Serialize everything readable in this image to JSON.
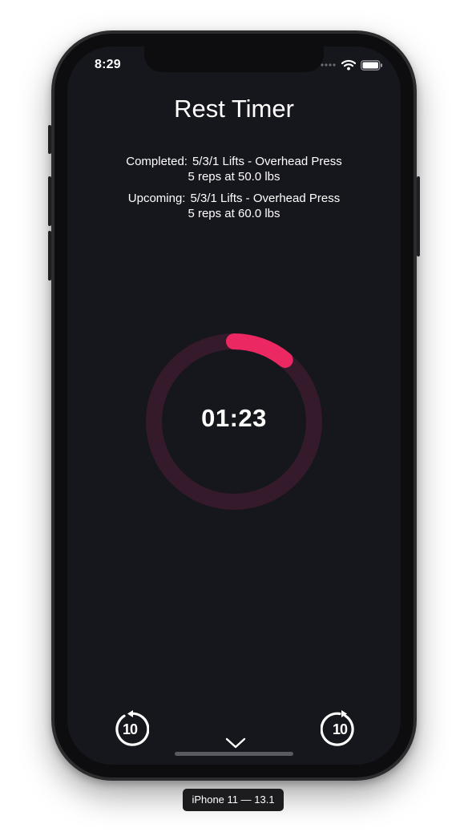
{
  "status_bar": {
    "time": "8:29",
    "signal_icon": "signal-dots-icon",
    "wifi_icon": "wifi-icon",
    "battery_icon": "battery-icon"
  },
  "header": {
    "title": "Rest Timer"
  },
  "completed": {
    "label": "Completed:",
    "exercise": "5/3/1 Lifts - Overhead Press",
    "detail": "5 reps at 50.0 lbs"
  },
  "upcoming": {
    "label": "Upcoming:",
    "exercise": "5/3/1 Lifts - Overhead Press",
    "detail": "5 reps at 60.0 lbs"
  },
  "timer": {
    "display": "01:23",
    "progress_fraction": 0.11,
    "accent_color": "#ec2863",
    "track_color": "#351a2c"
  },
  "controls": {
    "skip_back_label": "10",
    "skip_back_icon": "rewind-10-icon",
    "skip_forward_label": "10",
    "skip_forward_icon": "forward-10-icon",
    "dismiss_icon": "chevron-down-icon"
  },
  "simulator": {
    "device_label": "iPhone 11 — 13.1"
  }
}
